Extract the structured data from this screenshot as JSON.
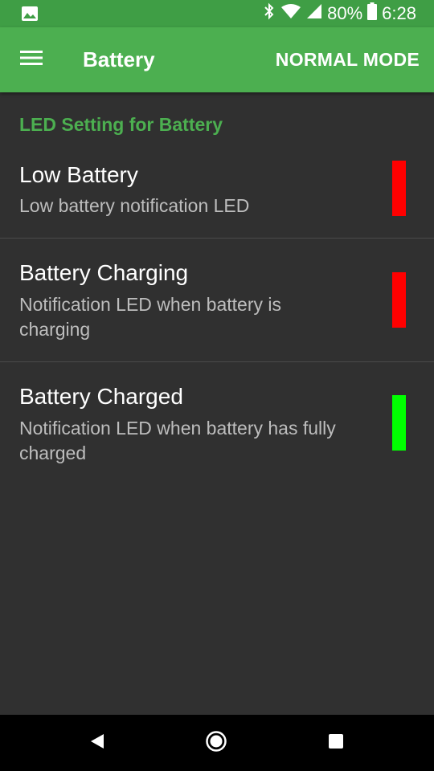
{
  "status_bar": {
    "battery_percent": "80%",
    "time": "6:28",
    "icons": [
      "image-icon",
      "bluetooth-icon",
      "wifi-icon",
      "cell-signal-icon",
      "battery-icon"
    ]
  },
  "app_bar": {
    "title": "Battery",
    "mode_label": "NORMAL MODE",
    "menu_icon": "hamburger-menu-icon"
  },
  "section": {
    "header": "LED Setting for Battery"
  },
  "items": [
    {
      "title": "Low Battery",
      "summary": "Low battery notification LED",
      "led_color": "#ff0000"
    },
    {
      "title": "Battery Charging",
      "summary": "Notification LED when battery is charging",
      "led_color": "#ff0000"
    },
    {
      "title": "Battery Charged",
      "summary": "Notification LED when battery has fully charged",
      "led_color": "#00ff00"
    }
  ],
  "nav_bar": {
    "icons": [
      "back-icon",
      "home-icon",
      "recents-icon"
    ]
  },
  "colors": {
    "status_bar": "#3f9e45",
    "app_bar": "#4caf50",
    "accent": "#4caf50",
    "background": "#303030"
  }
}
